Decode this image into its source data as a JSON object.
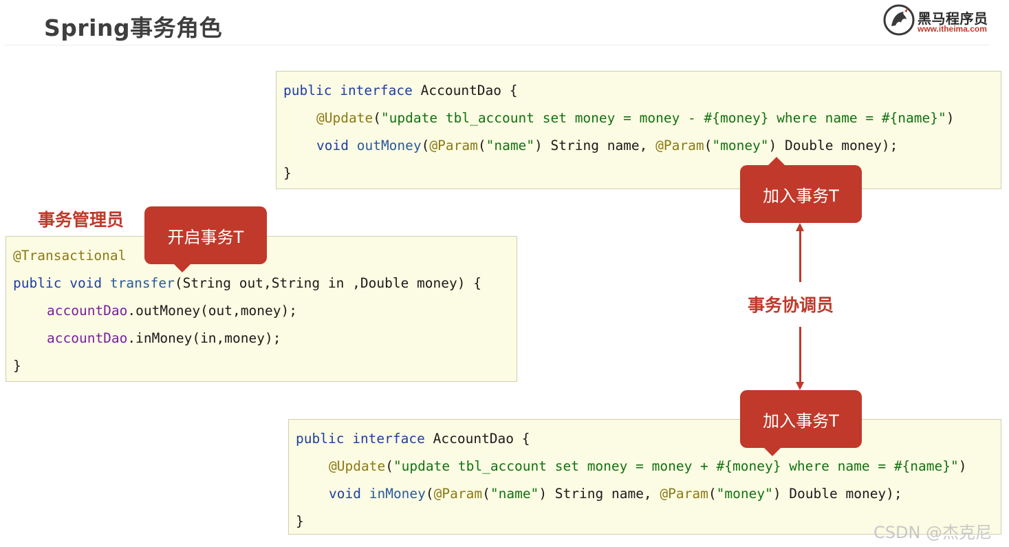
{
  "slide": {
    "title": "Spring事务角色"
  },
  "logo": {
    "name": "黑马程序员",
    "url": "www.itheima.com",
    "icon": "horse-logo-icon"
  },
  "top_code": {
    "line1": {
      "kw1": "public",
      "kw2": "interface",
      "rest": "AccountDao {"
    },
    "line2": {
      "ann": "@Update",
      "open": "(",
      "str": "\"update tbl_account set money = money - #{money} where name = #{name}\"",
      "close": ")"
    },
    "line3": {
      "kw": "void",
      "fn": "outMoney",
      "p1": "(",
      "ann1": "@Param",
      "p2": "(",
      "s1": "\"name\"",
      "p3": ") String name, ",
      "ann2": "@Param",
      "p4": "(",
      "s2": "\"money\"",
      "p5": ") Double money);"
    },
    "line4": "}"
  },
  "middle_code": {
    "line1": "@Transactional",
    "line2": {
      "kw1": "public",
      "kw2": "void",
      "fn": "transfer",
      "rest": "(String out,String in ,Double money) {"
    },
    "line3": {
      "field": "accountDao",
      "rest": ".outMoney(out,money);"
    },
    "line4": {
      "field": "accountDao",
      "rest": ".inMoney(in,money);"
    },
    "line5": "}"
  },
  "bottom_code": {
    "line1": {
      "kw1": "public",
      "kw2": "interface",
      "rest": "AccountDao {"
    },
    "line2": {
      "ann": "@Update",
      "open": "(",
      "str": "\"update tbl_account set money = money + #{money} where name = #{name}\"",
      "close": ")"
    },
    "line3": {
      "kw": "void",
      "fn": "inMoney",
      "p1": "(",
      "ann1": "@Param",
      "p2": "(",
      "s1": "\"name\"",
      "p3": ") String name, ",
      "ann2": "@Param",
      "p4": "(",
      "s2": "\"money\"",
      "p5": ") Double money);"
    },
    "line4": "}"
  },
  "bubbles": {
    "start": "开启事务T",
    "join_top": "加入事务T",
    "join_bottom": "加入事务T"
  },
  "roles": {
    "manager": "事务管理员",
    "coordinator": "事务协调员"
  },
  "colors": {
    "accent_red": "#c0392b",
    "code_bg": "#fcfbe3"
  },
  "watermark": "CSDN @杰克尼"
}
